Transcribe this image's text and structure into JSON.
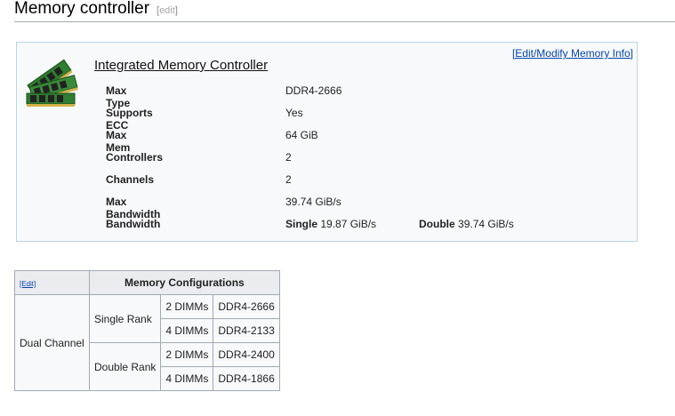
{
  "section": {
    "title": "Memory controller",
    "edit_label": "edit"
  },
  "memory_card": {
    "edit_link": "[Edit/Modify Memory Info]",
    "title": "Integrated Memory Controller",
    "rows": [
      {
        "label": "Max Type",
        "value": "DDR4-2666"
      },
      {
        "label": "Supports ECC",
        "value": "Yes"
      },
      {
        "label": "Max Mem",
        "value": "64 GiB"
      },
      {
        "label": "Controllers",
        "value": "2"
      },
      {
        "label": "Channels",
        "value": "2"
      },
      {
        "label": "Max Bandwidth",
        "value": "39.74 GiB/s"
      }
    ],
    "bandwidth": {
      "label": "Bandwidth",
      "single_label": "Single",
      "single_value": "19.87 GiB/s",
      "double_label": "Double",
      "double_value": "39.74 GiB/s"
    }
  },
  "config_table": {
    "edit_label": "[Edit]",
    "title": "Memory Configurations",
    "channel": "Dual Channel",
    "ranks": [
      {
        "name": "Single Rank",
        "configs": [
          {
            "dimms": "2 DIMMs",
            "type": "DDR4-2666"
          },
          {
            "dimms": "4 DIMMs",
            "type": "DDR4-2133"
          }
        ]
      },
      {
        "name": "Double Rank",
        "configs": [
          {
            "dimms": "2 DIMMs",
            "type": "DDR4-2400"
          },
          {
            "dimms": "4 DIMMs",
            "type": "DDR4-1866"
          }
        ]
      }
    ]
  },
  "icons": {
    "memory_module": "memory-module-icon"
  }
}
